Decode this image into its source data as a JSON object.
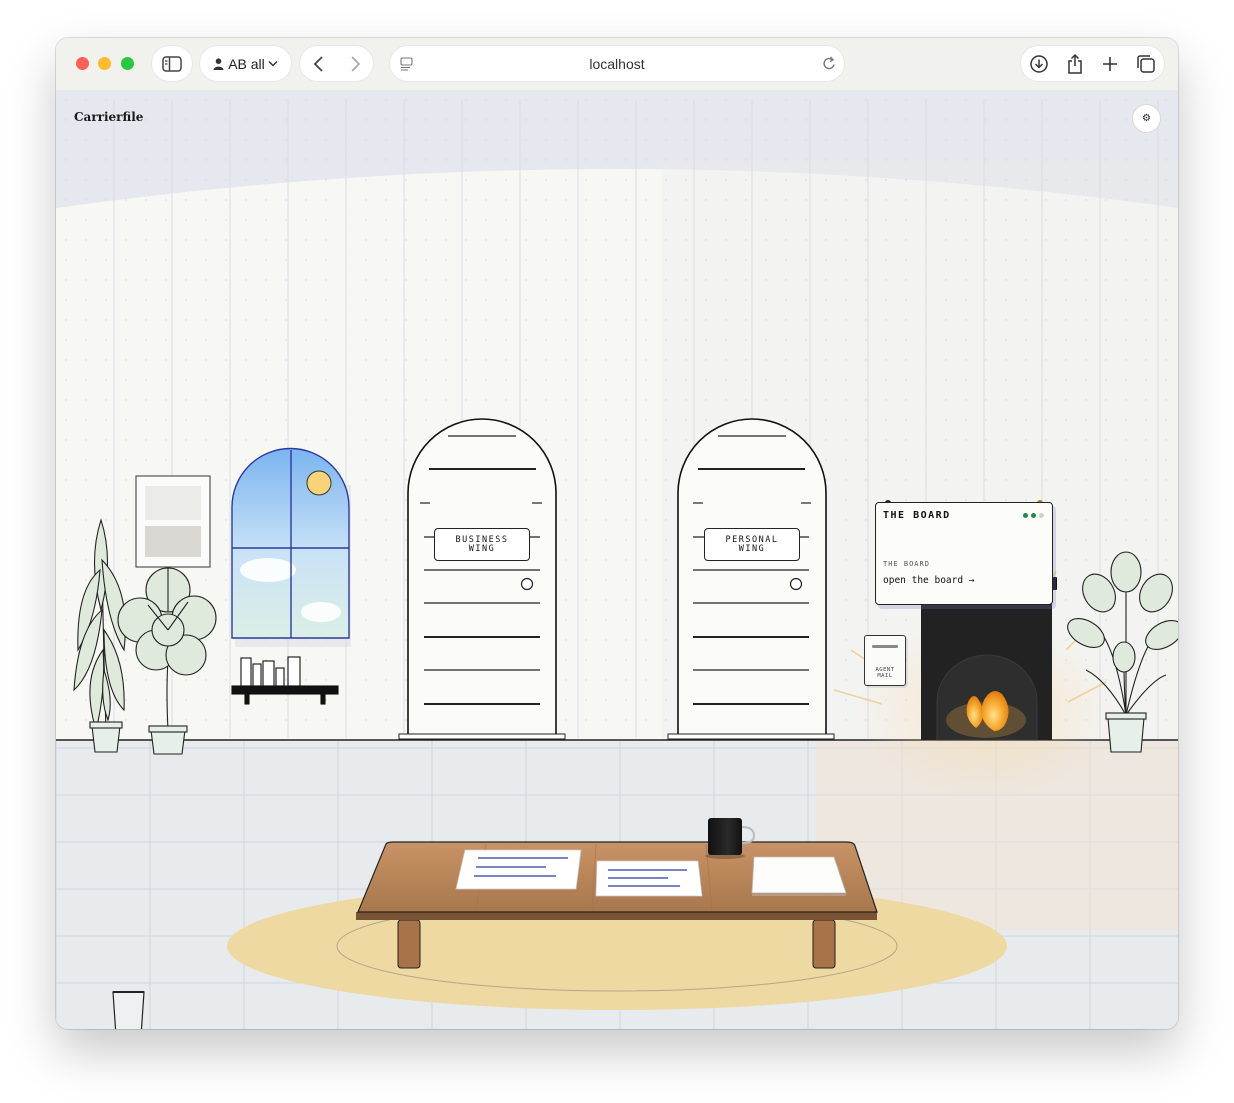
{
  "browser": {
    "profile_label": "AB all",
    "url": "localhost"
  },
  "page": {
    "brand": "Carrierfile",
    "settings_glyph": "⚙"
  },
  "scene": {
    "doors": [
      {
        "sign_line1": "BUSINESS",
        "sign_line2": "WING"
      },
      {
        "sign_line1": "PERSONAL",
        "sign_line2": "WING"
      }
    ],
    "board": {
      "title": "THE BOARD",
      "subtitle": "THE BOARD",
      "link": "open the board →"
    },
    "mail": {
      "label_line1": "AGENT",
      "label_line2": "MAIL"
    }
  },
  "colors": {
    "accent_blue": "#2b3aa0",
    "accent_yellow": "#e8a21b",
    "fire": "#f39b1c",
    "rug": "#eed9a2",
    "table": "#b98558"
  },
  "icons": [
    "sidebar-icon",
    "person-icon",
    "chevron-down-icon",
    "back-icon",
    "forward-icon",
    "page-icon",
    "reload-icon",
    "download-icon",
    "share-icon",
    "plus-icon",
    "tabs-icon",
    "gear-icon"
  ]
}
